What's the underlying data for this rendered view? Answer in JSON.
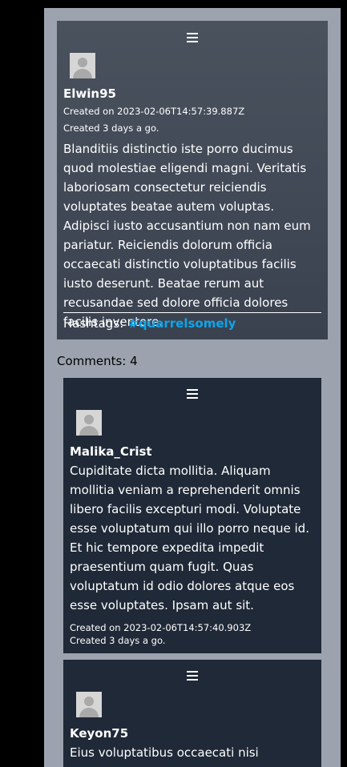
{
  "post": {
    "username": "Elwin95",
    "created_on": "Created on 2023-02-06T14:57:39.887Z",
    "created_ago": "Created 3 days a go.",
    "content": "Blanditiis distinctio iste porro ducimus quod molestiae eligendi magni. Veritatis laboriosam consectetur reiciendis voluptates beatae autem voluptas. Adipisci iusto accusantium non nam eum pariatur. Reiciendis dolorum officia occaecati distinctio voluptatibus facilis iusto deserunt. Beatae rerum aut recusandae sed dolore officia dolores facilis inventore.",
    "hashtags_label": "Hashtags:",
    "hashtags": [
      "#quarrelsomely"
    ]
  },
  "comments_label": "Comments: 4",
  "comments": [
    {
      "username": "Malika_Crist",
      "content": "Cupiditate dicta mollitia. Aliquam mollitia veniam a reprehenderit omnis libero facilis excepturi modi. Voluptate esse voluptatum qui illo porro neque id. Et hic tempore expedita impedit praesentium quam fugit. Quas voluptatum id odio dolores atque eos esse voluptates. Ipsam aut sit.",
      "created_on": "Created on 2023-02-06T14:57:40.903Z",
      "created_ago": "Created 3 days a go."
    },
    {
      "username": "Keyon75",
      "content": "Eius voluptatibus occaecati nisi"
    }
  ],
  "colors": {
    "page_bg": "#9ca3af",
    "post_bg": "#454d59",
    "comment_bg": "#1f2937",
    "hashtag": "#0ea5e9"
  },
  "icons": {
    "menu": "hamburger-menu-icon",
    "avatar": "avatar-placeholder-icon"
  }
}
